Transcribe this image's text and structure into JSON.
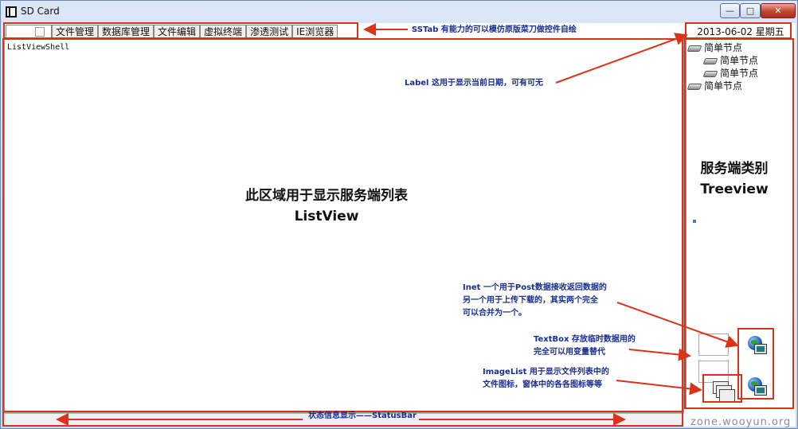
{
  "window": {
    "title": "SD Card",
    "controls": {
      "minimize": "—",
      "maximize": "□",
      "close": "✕"
    }
  },
  "tabs": [
    "文件管理",
    "数据库管理",
    "文件编辑",
    "虚拟终端",
    "渗透测试",
    "IE浏览器"
  ],
  "date_label": "2013-06-02  星期五",
  "listview": {
    "name": "ListViewShell"
  },
  "tree": {
    "nodes": [
      "简单节点",
      "简单节点",
      "简单节点",
      "简单节点"
    ]
  },
  "watermark": "zone.wooyun.org",
  "annotations": {
    "sstab": "SSTab 有能力的可以模仿原版菜刀做控件自绘",
    "label": "Label 这用于显示当前日期，可有可无",
    "listview_line1": "此区域用于显示服务端列表",
    "listview_line2": "ListView",
    "treeview_line1": "服务端类别",
    "treeview_line2": "Treeview",
    "inet_line1": "Inet 一个用于Post数据接收返回数据的",
    "inet_line2": "另一个用于上传下载的，其实两个完全",
    "inet_line3": "可以合并为一个。",
    "textbox_line1": "TextBox 存放临时数据用的",
    "textbox_line2": "完全可以用变量替代",
    "imagelist_line1": "ImageList 用于显示文件列表中的",
    "imagelist_line2": "文件图标，窗体中的各各图标等等",
    "statusbar": "状态信息显示——StatusBar"
  },
  "colors": {
    "annotation_red": "#d9341a",
    "annotation_blue": "#1a2d8f"
  },
  "icons": [
    "app-icon",
    "globe-computer-icon",
    "imagelist-icon",
    "tree-node-icon"
  ]
}
